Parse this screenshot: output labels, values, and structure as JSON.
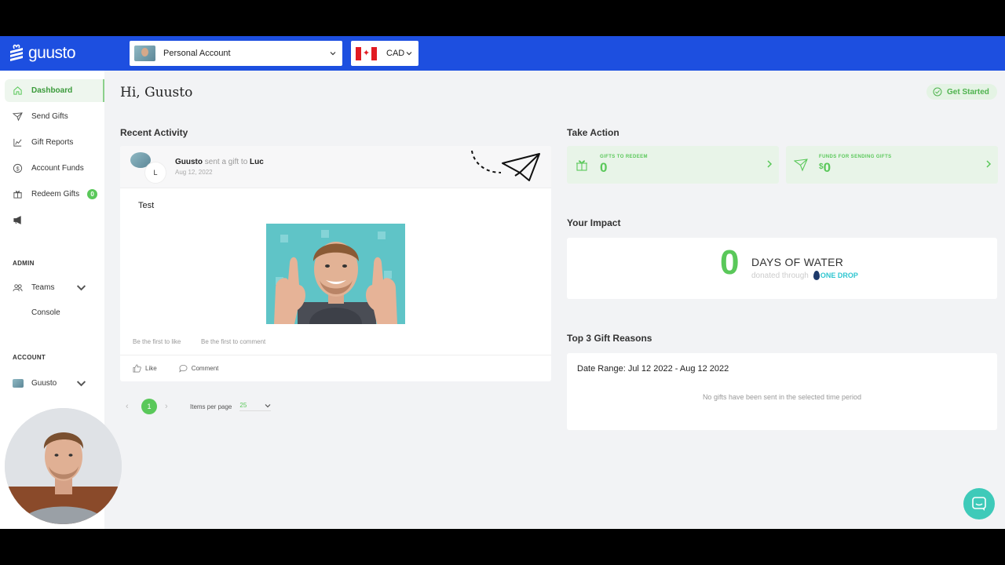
{
  "brand": {
    "name": "guusto",
    "accent": "#1d4fe0",
    "green": "#5ac85a"
  },
  "topbar": {
    "account_label": "Personal Account",
    "currency_label": "CAD"
  },
  "sidebar": {
    "items": [
      {
        "label": "Dashboard",
        "icon": "home-icon",
        "active": true
      },
      {
        "label": "Send Gifts",
        "icon": "paper-plane-icon"
      },
      {
        "label": "Gift Reports",
        "icon": "chart-icon"
      },
      {
        "label": "Account Funds",
        "icon": "dollar-circle-icon"
      },
      {
        "label": "Redeem Gifts",
        "icon": "gift-icon",
        "badge": "0"
      },
      {
        "label": "",
        "icon": "megaphone-icon"
      }
    ],
    "admin_label": "ADMIN",
    "admin_items": [
      {
        "label": "Teams",
        "icon": "people-icon"
      },
      {
        "label": "Console"
      }
    ],
    "account_section_label": "ACCOUNT",
    "account_user": "Guusto"
  },
  "main": {
    "greeting": "Hi, Guusto",
    "get_started": "Get Started",
    "recent_activity_title": "Recent Activity",
    "activity": {
      "sender": "Guusto",
      "verb": "sent a gift to",
      "recipient": "Luc",
      "date": "Aug 12, 2022",
      "recipient_initial": "L",
      "message": "Test",
      "like_hint": "Be the first to like",
      "comment_hint": "Be the first to comment",
      "like_label": "Like",
      "comment_label": "Comment"
    },
    "pagination": {
      "prev": "‹",
      "current": "1",
      "next": "›",
      "items_per_page_label": "Items per page",
      "items_per_page_value": "25"
    },
    "take_action_title": "Take Action",
    "gifts_to_redeem": {
      "caption": "GIFTS TO REDEEM",
      "value": "0"
    },
    "funds_for_sending": {
      "caption": "FUNDS FOR SENDING GIFTS",
      "currency": "$",
      "value": "0"
    },
    "impact_title": "Your Impact",
    "impact": {
      "number": "0",
      "title": "DAYS OF WATER",
      "subtitle": "donated through",
      "partner": "ONE DROP"
    },
    "reasons_title": "Top 3 Gift Reasons",
    "reasons": {
      "date_range": "Date Range: Jul 12 2022 - Aug 12 2022",
      "empty_message": "No gifts have been sent in the selected time period"
    }
  }
}
